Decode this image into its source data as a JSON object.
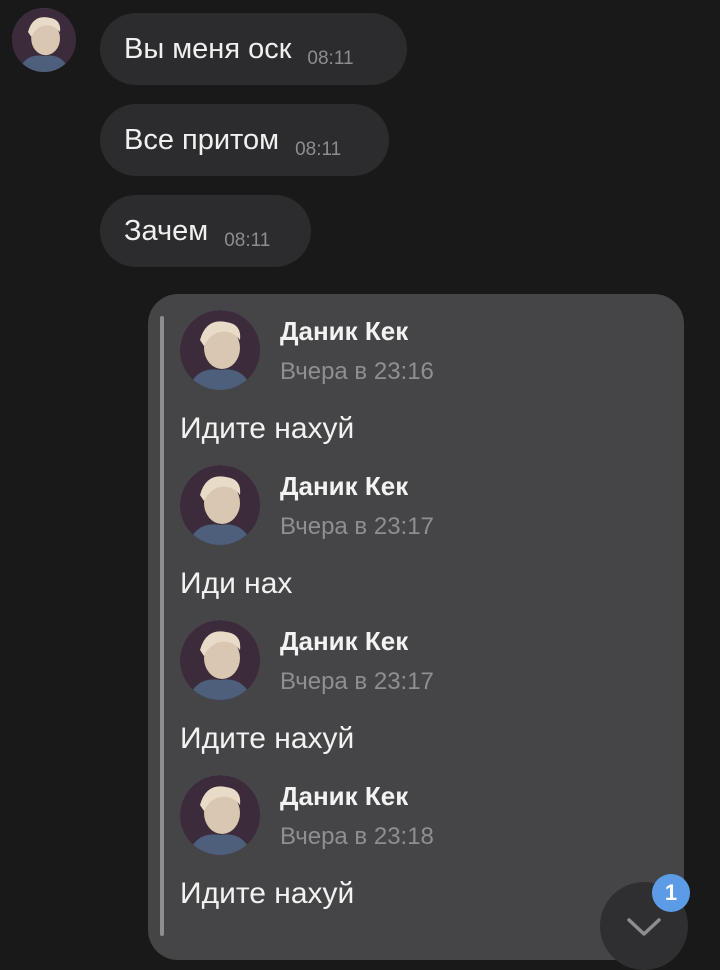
{
  "incoming_messages": [
    {
      "text": "Вы меня оск",
      "time": "08:11"
    },
    {
      "text": "Все притом",
      "time": "08:11"
    },
    {
      "text": "Зачем",
      "time": "08:11"
    }
  ],
  "forwarded": [
    {
      "name": "Даник Кек",
      "date": "Вчера в 23:16",
      "text": "Идите нахуй"
    },
    {
      "name": "Даник Кек",
      "date": "Вчера в 23:17",
      "text": "Иди нах"
    },
    {
      "name": "Даник Кек",
      "date": "Вчера в 23:17",
      "text": "Идите нахуй"
    },
    {
      "name": "Даник Кек",
      "date": "Вчера в 23:18",
      "text": "Идите нахуй"
    }
  ],
  "scroll_button": {
    "icon": "chevron-down-icon",
    "unread_count": "1"
  },
  "colors": {
    "background": "#19191a",
    "bubble": "#2c2c2e",
    "forward_card": "#454547",
    "badge": "#5c9ce6"
  }
}
